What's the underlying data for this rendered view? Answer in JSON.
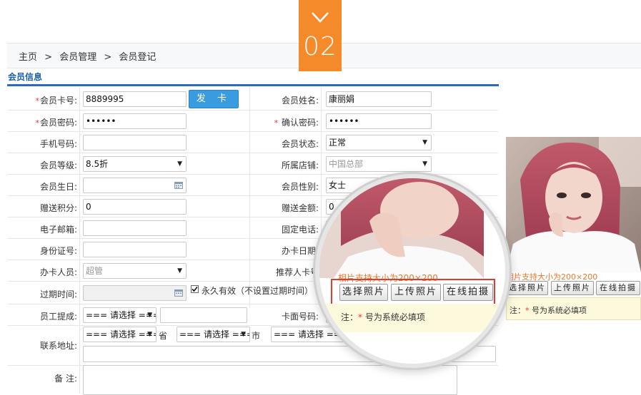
{
  "step": {
    "number": "02"
  },
  "breadcrumb": {
    "home": "主页",
    "sep1": ">",
    "module": "会员管理",
    "sep2": ">",
    "page": "会员登记"
  },
  "section": {
    "title": "会员信息"
  },
  "form": {
    "card_no": {
      "label": "会员卡号:",
      "value": "8889995"
    },
    "issue_button": "发 卡",
    "member_name": {
      "label": "会员姓名:",
      "value": "康丽娟"
    },
    "password": {
      "label": "会员密码:",
      "value": "••••••"
    },
    "confirm_password": {
      "label": "确认密码:",
      "value": "••••••"
    },
    "phone": {
      "label": "手机号码:",
      "value": ""
    },
    "status": {
      "label": "会员状态:",
      "value": "正常"
    },
    "level": {
      "label": "会员等级:",
      "value": "8.5折"
    },
    "store": {
      "label": "所属店铺:",
      "value": "中国总部"
    },
    "birthday": {
      "label": "会员生日:",
      "value": ""
    },
    "gender": {
      "label": "会员性别:",
      "value": "女士"
    },
    "bonus_points": {
      "label": "赠送积分:",
      "value": "0"
    },
    "bonus_amount": {
      "label": "赠送金额:",
      "value": "0"
    },
    "email": {
      "label": "电子邮箱:",
      "value": ""
    },
    "landline": {
      "label": "固定电话:",
      "value": ""
    },
    "id_no": {
      "label": "身份证号:",
      "value": ""
    },
    "issue_date": {
      "label": "办卡日期:",
      "value": ""
    },
    "issuer": {
      "label": "办卡人员:",
      "value": "超管"
    },
    "referrer": {
      "label": "推荐人卡号",
      "value": ""
    },
    "expiry": {
      "label": "过期时间:",
      "value": ""
    },
    "permanent": {
      "label": "永久有效（不设置过期时间）",
      "checked": true
    },
    "staff_commission": {
      "label": "员工提成:",
      "select": "=== 请选择 ===",
      "value": ""
    },
    "card_face": {
      "label": "卡面号码:",
      "value": ""
    },
    "address": {
      "label": "联系地址:",
      "province_select": "=== 请选择 ===",
      "province_suffix": "省",
      "city_select": "=== 请选择 ===",
      "city_suffix": "市",
      "district_select": "=== 请选择 ===",
      "value": ""
    },
    "remark": {
      "label": "备 注:",
      "value": ""
    }
  },
  "photo_panel": {
    "hint": "相片支持大小为200×200",
    "buttons": [
      "选择照片",
      "上传照片",
      "在线拍摄"
    ],
    "note_prefix": "注：",
    "note_star": "*",
    "note_text": " 号为系统必填项"
  },
  "colors": {
    "accent": "#f58a2a",
    "primary": "#2a6db5",
    "required": "#e33333",
    "highlight": "#e23a2c"
  },
  "icons": [
    "chevron-down-icon",
    "calendar-icon",
    "checkbox-icon"
  ]
}
